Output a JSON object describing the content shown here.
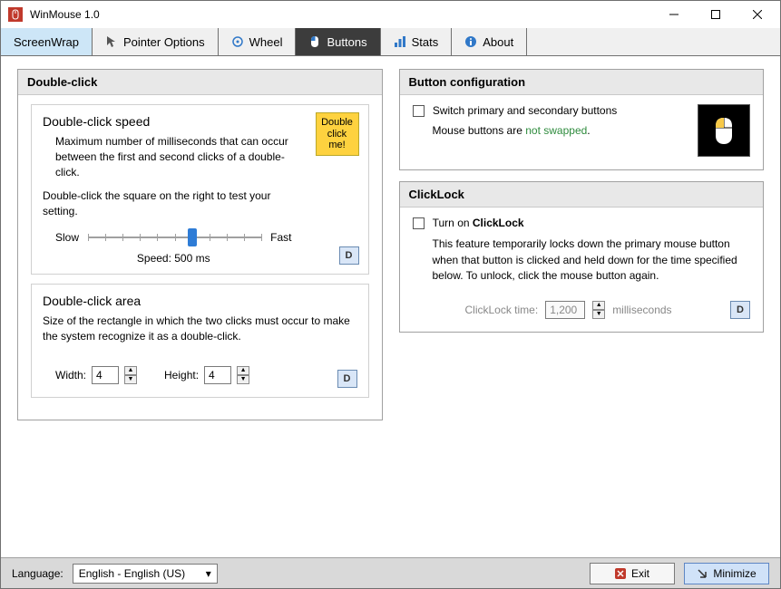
{
  "window": {
    "title": "WinMouse 1.0"
  },
  "tabs": {
    "screenwrap": "ScreenWrap",
    "pointer": "Pointer Options",
    "wheel": "Wheel",
    "buttons": "Buttons",
    "stats": "Stats",
    "about": "About"
  },
  "doubleclick": {
    "panel_title": "Double-click",
    "speed": {
      "title": "Double-click speed",
      "desc": "Maximum number of milliseconds that can occur between the first and second clicks of a double-click.",
      "test_hint": "Double-click the square on the right to test your setting.",
      "slow": "Slow",
      "fast": "Fast",
      "readout": "Speed: 500 ms",
      "yellow": "Double click me!",
      "thumb_position_pct": 60
    },
    "area": {
      "title": "Double-click area",
      "desc": "Size of the rectangle in which the two clicks must occur to make the system recognize it as a double-click.",
      "width_label": "Width:",
      "height_label": "Height:",
      "width_value": "4",
      "height_value": "4"
    }
  },
  "buttoncfg": {
    "panel_title": "Button configuration",
    "swap_label": "Switch primary and secondary buttons",
    "status_prefix": "Mouse buttons are ",
    "status_value": "not swapped",
    "status_suffix": "."
  },
  "clicklock": {
    "panel_title": "ClickLock",
    "turn_on_prefix": "Turn on ",
    "turn_on_bold": "ClickLock",
    "desc": "This feature temporarily locks down the primary mouse button when that button is clicked and held down for the time specified below. To unlock, click the mouse button again.",
    "time_label": "ClickLock time:",
    "time_value": "1,200",
    "time_unit": "milliseconds"
  },
  "buttons_generic": {
    "default_label": "D"
  },
  "footer": {
    "language_label": "Language:",
    "language_value": "English  -  English (US)",
    "exit": "Exit",
    "minimize": "Minimize"
  }
}
